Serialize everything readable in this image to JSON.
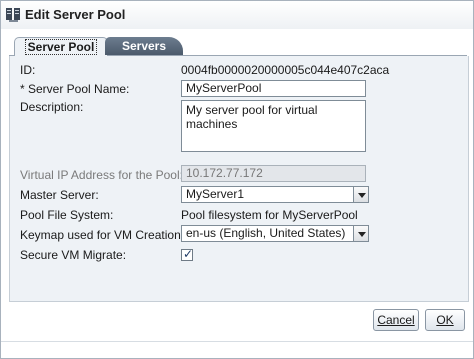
{
  "window": {
    "title": "Edit Server Pool",
    "icon": "server-pool-icon"
  },
  "tabs": [
    {
      "label": "Server Pool",
      "active": true
    },
    {
      "label": "Servers",
      "active": false
    }
  ],
  "form": {
    "id_label": "ID:",
    "id_value": "0004fb0000020000005c044e407c2aca",
    "name_label": "* Server Pool Name:",
    "name_value": "MyServerPool",
    "description_label": "Description:",
    "description_value": "My server pool for virtual machines",
    "vip_label": "Virtual IP Address for the Pool:",
    "vip_value": "10.172.77.172",
    "master_label": "Master Server:",
    "master_value": "MyServer1",
    "filesystem_label": "Pool File System:",
    "filesystem_value": "Pool filesystem for MyServerPool",
    "keymap_label": "Keymap used for VM Creation:",
    "keymap_value": "en-us (English, United States)",
    "secure_label": "Secure VM Migrate:",
    "secure_checked": true
  },
  "buttons": {
    "cancel": "Cancel",
    "ok": "OK"
  }
}
